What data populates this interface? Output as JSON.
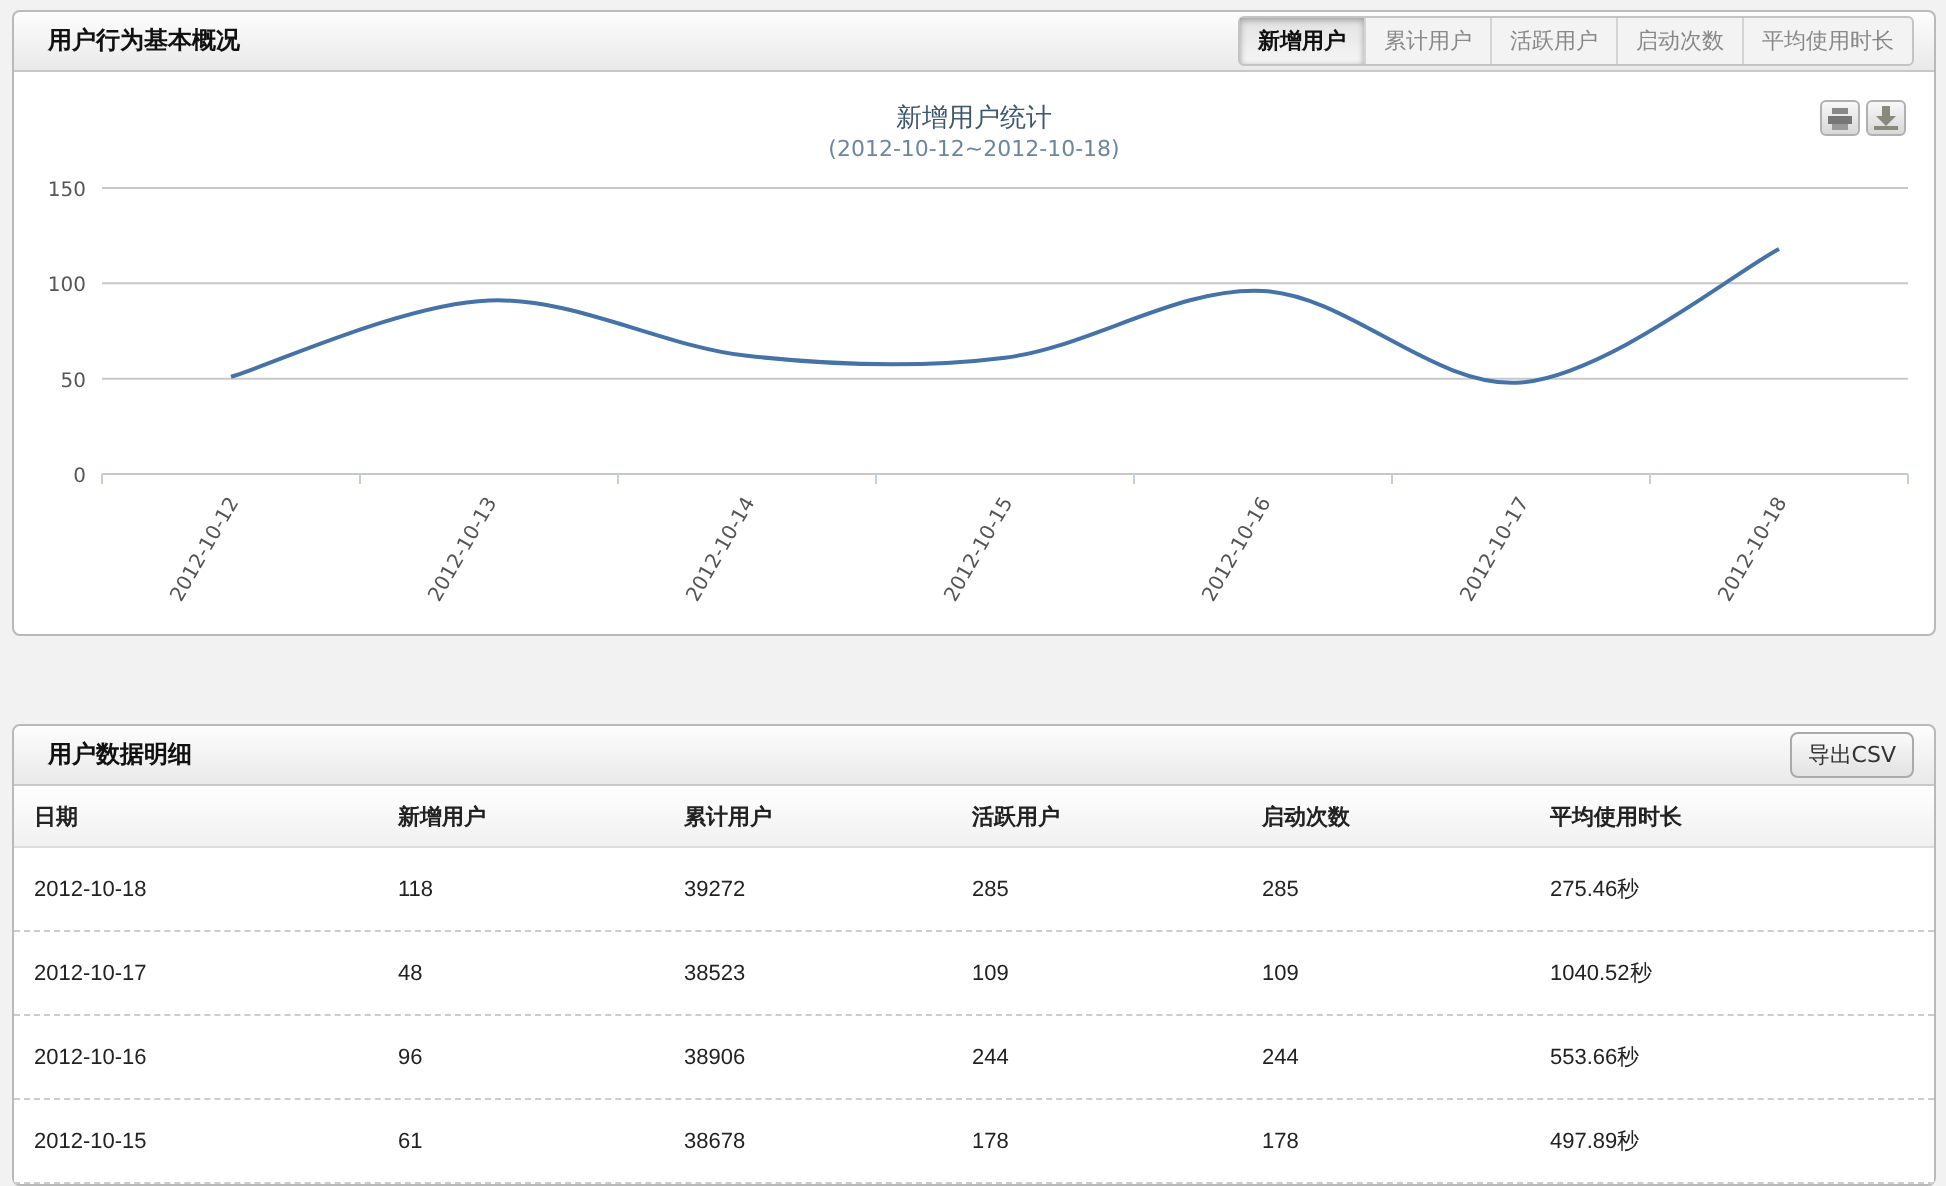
{
  "overview_panel": {
    "title": "用户行为基本概况",
    "tabs": [
      {
        "label": "新增用户",
        "selected": true
      },
      {
        "label": "累计用户",
        "selected": false
      },
      {
        "label": "活跃用户",
        "selected": false
      },
      {
        "label": "启动次数",
        "selected": false
      },
      {
        "label": "平均使用时长",
        "selected": false
      }
    ],
    "chart_data": {
      "type": "line",
      "title": "新增用户统计",
      "subtitle": "(2012-10-12~2012-10-18)",
      "categories": [
        "2012-10-12",
        "2012-10-13",
        "2012-10-14",
        "2012-10-15",
        "2012-10-16",
        "2012-10-17",
        "2012-10-18"
      ],
      "series": [
        {
          "color": "#4572a7",
          "values": [
            51,
            91,
            62,
            61,
            96,
            48,
            118
          ]
        }
      ],
      "ylim": [
        0,
        150
      ],
      "yticks": [
        0,
        50,
        100,
        150
      ]
    }
  },
  "detail_panel": {
    "title": "用户数据明细",
    "export_button": "导出CSV",
    "table": {
      "columns": [
        "日期",
        "新增用户",
        "累计用户",
        "活跃用户",
        "启动次数",
        "平均使用时长"
      ],
      "rows": [
        [
          "2012-10-18",
          "118",
          "39272",
          "285",
          "285",
          "275.46秒"
        ],
        [
          "2012-10-17",
          "48",
          "38523",
          "109",
          "109",
          "1040.52秒"
        ],
        [
          "2012-10-16",
          "96",
          "38906",
          "244",
          "244",
          "553.66秒"
        ],
        [
          "2012-10-15",
          "61",
          "38678",
          "178",
          "178",
          "497.89秒"
        ]
      ]
    }
  }
}
